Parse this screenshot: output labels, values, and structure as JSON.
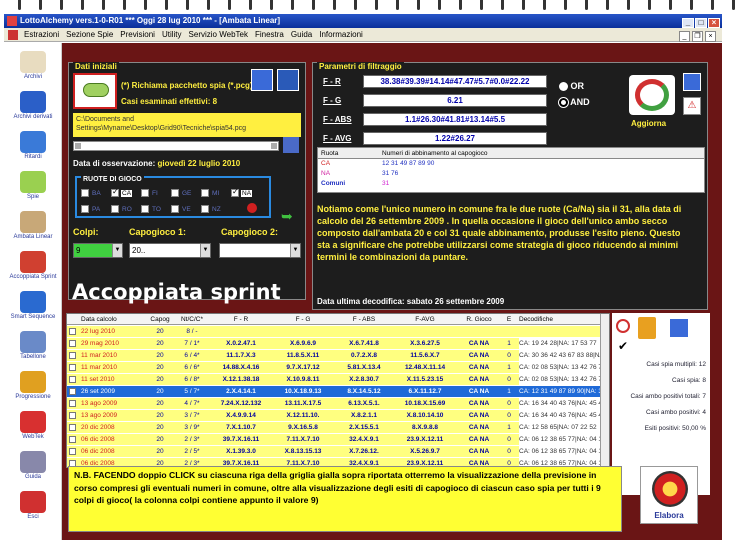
{
  "window": {
    "title": "LottoAlchemy vers.1-0-R01  ***  Oggi 28 lug 2010  ***  - [Ambata Linear]"
  },
  "menu": [
    "Estrazioni",
    "Sezione Spie",
    "Previsioni",
    "Utility",
    "Servizio WebTek",
    "Finestra",
    "Guida",
    "Informazioni"
  ],
  "sidebar": [
    {
      "label": "Archivi",
      "color": "#e8dcc0"
    },
    {
      "label": "Archivi derivati",
      "color": "#2b5fc8"
    },
    {
      "label": "Ritardi",
      "color": "#3a7ad8"
    },
    {
      "label": "Spie",
      "color": "#9ad050"
    },
    {
      "label": "Ambata Linear",
      "color": "#c8a878"
    },
    {
      "label": "Accoppiata Sprint",
      "color": "#d04030"
    },
    {
      "label": "Smart Sequence",
      "color": "#2a6ad0"
    },
    {
      "label": "Tabellone",
      "color": "#6a8ac8"
    },
    {
      "label": "Progressione",
      "color": "#e0a020"
    },
    {
      "label": "WebTek",
      "color": "#d83030"
    },
    {
      "label": "Guida",
      "color": "#8888aa"
    },
    {
      "label": "Esci",
      "color": "#d03030"
    }
  ],
  "dati": {
    "title": "Dati iniziali",
    "richiama": "(*) Richiama pacchetto spia (*.pcg)",
    "casi": "Casi esaminati effettivi: 8",
    "path": "C:\\Documents and Settings\\Myname\\Desktop\\Grid90\\Tecniche\\spia54.pcg",
    "data_label": "Data di osservazione:",
    "data_value": "giovedì 22 luglio 2010",
    "ruote_title": "RUOTE DI GIOCO",
    "ruote_row1": [
      {
        "n": "BA",
        "on": false
      },
      {
        "n": "CA",
        "on": true
      },
      {
        "n": "FI",
        "on": false
      },
      {
        "n": "GE",
        "on": false
      },
      {
        "n": "MI",
        "on": false
      },
      {
        "n": "NA",
        "on": true
      }
    ],
    "ruote_row2": [
      {
        "n": "PA",
        "on": false
      },
      {
        "n": "RO",
        "on": false
      },
      {
        "n": "TO",
        "on": false
      },
      {
        "n": "VE",
        "on": false
      },
      {
        "n": "NZ",
        "on": false
      }
    ],
    "colpi_label": "Colpi:",
    "colpi_value": "9",
    "capo1_label": "Capogioco 1:",
    "capo1_value": "20..",
    "capo2_label": "Capogioco 2:",
    "capo2_value": ""
  },
  "param": {
    "title": "Parametri di filtraggio",
    "rows": [
      {
        "label": "F - R",
        "value": "38.38#39.39#14.14#47.47#5.7#0.0#22.22"
      },
      {
        "label": "F - G",
        "value": "6.21"
      },
      {
        "label": "F - ABS",
        "value": "1.1#26.30#41.81#13.14#5.5"
      },
      {
        "label": "F - AVG",
        "value": "1.22#26.27"
      }
    ],
    "or_label": "OR",
    "and_label": "AND",
    "aggiorna": "Aggiorna",
    "table_headers": [
      "Ruota",
      "Numeri di abbinamento al capogioco"
    ],
    "table_rows": [
      {
        "r": "CA",
        "n": "12 31 49 87 89 90"
      },
      {
        "r": "NA",
        "n": "31 76"
      },
      {
        "r": "Comuni",
        "n": "31"
      }
    ],
    "note": "Notiamo come l'unico numero in comune fra le due ruote (Ca/Na) sia il 31, alla data di calcolo del 26 settembre 2009 . In quella occasione il gioco dell'unico ambo secco composto dall'ambata 20 e col 31 quale abbinamento, produsse l'esito pieno. Questo sta a significare che potrebbe utilizzarsi come strategia di gioco riducendo ai minimi termini le combinazioni da puntare.",
    "ultima": "Data ultima decodifica: sabato 26 settembre 2009"
  },
  "banner": "Accoppiata sprint",
  "grid": {
    "headers": [
      "Data calcolo",
      "Capog",
      "Nt/C/C*",
      "F - R",
      "F - G",
      "F - ABS",
      "F-AVG",
      "R. Gioco",
      "E",
      "Decodifiche"
    ],
    "rows": [
      [
        "22 lug 2010",
        "20",
        "8 / -",
        "",
        "",
        "",
        "",
        "",
        "",
        ""
      ],
      [
        "29 mag 2010",
        "20",
        "7 / 1*",
        "X.0.2.47.1",
        "X.6.9.6.9",
        "X.6.7.41.8",
        "X.3.6.27.5",
        "CA NA",
        "1",
        "CA: 19 24 28|NA: 17 53 77"
      ],
      [
        "11 mar 2010",
        "20",
        "6 / 4*",
        "11.1.7.X.3",
        "11.8.5.X.11",
        "0.7.2.X.8",
        "11.5.6.X.7",
        "CA NA",
        "0",
        "CA: 30 36 42 43 67 83 88|NA:"
      ],
      [
        "11 mar 2010",
        "20",
        "6 / 6*",
        "14.88.X.4.16",
        "9.7.X.17.12",
        "5.81.X.13.4",
        "12.48.X.11.14",
        "CA NA",
        "1",
        "CA: 02 08 53|NA: 13 42 76 77 8"
      ],
      [
        "11 set 2010",
        "20",
        "6 / 8*",
        "X.12.1.38.18",
        "X.10.9.8.11",
        "X.2.8.30.7",
        "X.11.5.23.15",
        "CA NA",
        "0",
        "CA: 02 08 53|NA: 13 42 76 77 8"
      ],
      [
        "26 set 2009",
        "20",
        "5 / 7*",
        "2.X.4.14.1",
        "10.X.18.9.13",
        "8.X.14.5.12",
        "6.X.11.12.7",
        "CA NA",
        "1",
        "CA: 12 31 49 87 89 90|NA: 31 7"
      ],
      [
        "13 ago 2009",
        "20",
        "4 / 7*",
        "7.24.X.12.132",
        "13.11.X.17.5",
        "6.13.X.5.1.",
        "10.18.X.15.69",
        "CA NA",
        "0",
        "CA: 16 34 40 43 76|NA: 45 46 5"
      ],
      [
        "13 ago 2009",
        "20",
        "3 / 7*",
        "X.4.9.9.14",
        "X.12.11.10.",
        "X.8.2.1.1",
        "X.8.10.14.10",
        "CA NA",
        "0",
        "CA: 16 34 40 43 76|NA: 45 46 5"
      ],
      [
        "20 dic 2008",
        "20",
        "3 / 9*",
        "7.X.1.10.7",
        "9.X.16.5.8",
        "2.X.15.5.1",
        "8.X.9.8.8",
        "CA NA",
        "1",
        "CA: 12 58 65|NA: 07 22 52"
      ],
      [
        "06 dic 2008",
        "20",
        "2 / 3*",
        "39.7.X.16.11",
        "7.11.X.7.10",
        "32.4.X.9.1",
        "23.9.X.12.11",
        "CA NA",
        "0",
        "CA: 06 12 38 65 77|NA: 04 13 2"
      ],
      [
        "06 dic 2008",
        "20",
        "2 / 5*",
        "X.1.39.3.0",
        "X.8.13.15.13",
        "X.7.26.12.",
        "X.5.26.9.7",
        "CA NA",
        "0",
        "CA: 06 12 38 65 77|NA: 04 13 2"
      ],
      [
        "06 dic 2008",
        "20",
        "2 / 3*",
        "39.7.X.16.11",
        "7.11.X.7.10",
        "32.4.X.9.1",
        "23.9.X.12.11",
        "CA NA",
        "0",
        "CA: 06 12 38 65 77|NA: 04 13 2"
      ]
    ]
  },
  "bottom_note": "N.B. FACENDO doppio CLICK su ciascuna riga della griglia gialla sopra riportata otterremo la visualizzazione della previsione in corso compresi gli eventuali numeri in comune, oltre alla visualizzazione degli esiti di capogioco di ciascun caso spia per tutti i 9 colpi di gioco( la colonna colpi contiene appunto il valore 9)",
  "stats": {
    "multipli": "Casi spia multipli: 12",
    "spia": "Casi spia: 8",
    "ambo_tot": "Casi ambo positivi totali: 7",
    "ambo_pos": "Casi ambo positivi: 4",
    "esiti": "Esiti positivi: 50,00 %",
    "elabora": "Elabora"
  }
}
